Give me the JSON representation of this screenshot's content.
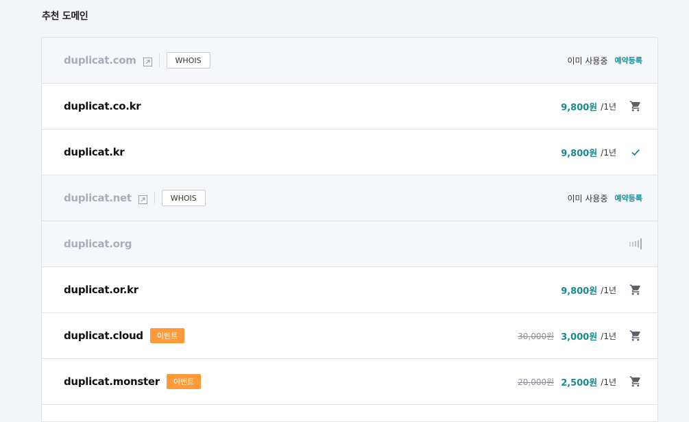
{
  "section": {
    "title": "추천 도메인"
  },
  "labels": {
    "whois": "WHOIS",
    "in_use": "이미 사용중",
    "reserve": "예약등록",
    "event": "이벤트"
  },
  "domains": [
    {
      "name": "duplicat.com",
      "status": "taken"
    },
    {
      "name": "duplicat.co.kr",
      "status": "available",
      "price": "9,800원",
      "period": "/1년",
      "action": "cart-icon"
    },
    {
      "name": "duplicat.kr",
      "status": "selected",
      "price": "9,800원",
      "period": "/1년",
      "action": "check-icon"
    },
    {
      "name": "duplicat.net",
      "status": "taken"
    },
    {
      "name": "duplicat.org",
      "status": "checking",
      "action": "loading-icon"
    },
    {
      "name": "duplicat.or.kr",
      "status": "available",
      "price": "9,800원",
      "period": "/1년",
      "action": "cart-icon"
    },
    {
      "name": "duplicat.cloud",
      "status": "event",
      "original_price": "30,000원",
      "price": "3,000원",
      "period": "/1년",
      "action": "cart-icon"
    },
    {
      "name": "duplicat.monster",
      "status": "event",
      "original_price": "20,000원",
      "price": "2,500원",
      "period": "/1년",
      "action": "cart-icon"
    }
  ],
  "colors": {
    "accent": "#168a93",
    "event_badge": "#ff9a3a",
    "taken_text": "#a9adb5"
  }
}
